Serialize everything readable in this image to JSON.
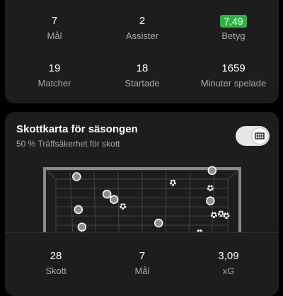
{
  "player_stats": {
    "goals": {
      "value": "7",
      "label": "Mål"
    },
    "assists": {
      "value": "2",
      "label": "Assister"
    },
    "rating": {
      "value": "7,49",
      "label": "Betyg",
      "color": "#29b543"
    },
    "matches": {
      "value": "19",
      "label": "Matcher"
    },
    "started": {
      "value": "18",
      "label": "Startade"
    },
    "minutes": {
      "value": "1659",
      "label": "Minuter spelade"
    }
  },
  "shotmap": {
    "title": "Skottkarta för säsongen",
    "subtitle": "50 % Träffsäkerhet för skott",
    "toggle_icon": "goal-net-icon",
    "summary": {
      "shots": {
        "value": "28",
        "label": "Skott"
      },
      "goals": {
        "value": "7",
        "label": "Mål"
      },
      "xg": {
        "value": "3,09",
        "label": "xG"
      }
    }
  },
  "shots": [
    {
      "kind": "save",
      "gx": 0.14,
      "gy": 0.12
    },
    {
      "kind": "save",
      "gx": 0.31,
      "gy": 0.38
    },
    {
      "kind": "save",
      "gx": 0.35,
      "gy": 0.46
    },
    {
      "kind": "save",
      "gx": 0.15,
      "gy": 0.61
    },
    {
      "kind": "save",
      "gx": 0.17,
      "gy": 0.87
    },
    {
      "kind": "save",
      "gx": 0.6,
      "gy": 0.81
    },
    {
      "kind": "save",
      "gx": 0.9,
      "gy": 0.03
    },
    {
      "kind": "save",
      "gx": 0.89,
      "gy": 0.48
    },
    {
      "kind": "goal",
      "gx": 0.68,
      "gy": 0.21
    },
    {
      "kind": "goal",
      "gx": 0.89,
      "gy": 0.29
    },
    {
      "kind": "goal",
      "gx": 0.4,
      "gy": 0.56
    },
    {
      "kind": "goal",
      "gx": 0.91,
      "gy": 0.69
    },
    {
      "kind": "goal",
      "gx": 0.95,
      "gy": 0.67
    },
    {
      "kind": "goal",
      "gx": 0.98,
      "gy": 0.7
    },
    {
      "kind": "goal",
      "gx": 0.83,
      "gy": 0.95
    }
  ]
}
